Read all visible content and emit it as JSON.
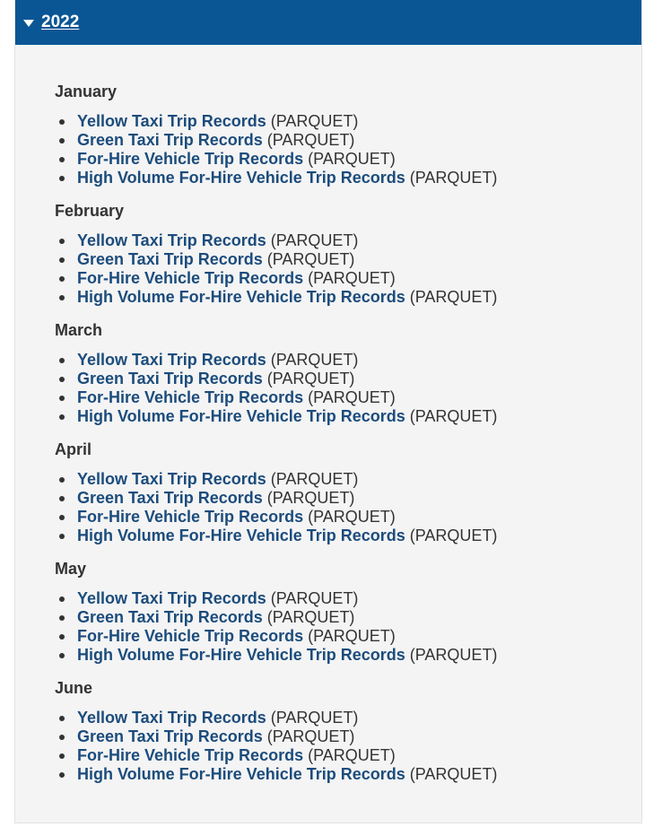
{
  "section": {
    "year": "2022"
  },
  "months": [
    {
      "name": "January",
      "records": [
        {
          "label": "Yellow Taxi Trip Records",
          "format": "(PARQUET)"
        },
        {
          "label": "Green Taxi Trip Records",
          "format": "(PARQUET)"
        },
        {
          "label": "For-Hire Vehicle Trip Records",
          "format": "(PARQUET)"
        },
        {
          "label": "High Volume For-Hire Vehicle Trip Records",
          "format": "(PARQUET)"
        }
      ]
    },
    {
      "name": "February",
      "records": [
        {
          "label": "Yellow Taxi Trip Records",
          "format": "(PARQUET)"
        },
        {
          "label": "Green Taxi Trip Records",
          "format": "(PARQUET)"
        },
        {
          "label": "For-Hire Vehicle Trip Records",
          "format": "(PARQUET)"
        },
        {
          "label": "High Volume For-Hire Vehicle Trip Records",
          "format": "(PARQUET)"
        }
      ]
    },
    {
      "name": "March",
      "records": [
        {
          "label": "Yellow Taxi Trip Records",
          "format": "(PARQUET)"
        },
        {
          "label": "Green Taxi Trip Records",
          "format": "(PARQUET)"
        },
        {
          "label": "For-Hire Vehicle Trip Records",
          "format": "(PARQUET)"
        },
        {
          "label": "High Volume For-Hire Vehicle Trip Records",
          "format": "(PARQUET)"
        }
      ]
    },
    {
      "name": "April",
      "records": [
        {
          "label": "Yellow Taxi Trip Records",
          "format": "(PARQUET)"
        },
        {
          "label": "Green Taxi Trip Records",
          "format": "(PARQUET)"
        },
        {
          "label": "For-Hire Vehicle Trip Records",
          "format": "(PARQUET)"
        },
        {
          "label": "High Volume For-Hire Vehicle Trip Records",
          "format": "(PARQUET)"
        }
      ]
    },
    {
      "name": "May",
      "records": [
        {
          "label": "Yellow Taxi Trip Records",
          "format": "(PARQUET)"
        },
        {
          "label": "Green Taxi Trip Records",
          "format": "(PARQUET)"
        },
        {
          "label": "For-Hire Vehicle Trip Records",
          "format": "(PARQUET)"
        },
        {
          "label": "High Volume For-Hire Vehicle Trip Records",
          "format": "(PARQUET)"
        }
      ]
    },
    {
      "name": "June",
      "records": [
        {
          "label": "Yellow Taxi Trip Records",
          "format": "(PARQUET)"
        },
        {
          "label": "Green Taxi Trip Records",
          "format": "(PARQUET)"
        },
        {
          "label": "For-Hire Vehicle Trip Records",
          "format": "(PARQUET)"
        },
        {
          "label": "High Volume For-Hire Vehicle Trip Records",
          "format": "(PARQUET)"
        }
      ]
    }
  ],
  "icons": {
    "toggle": "caret-down-icon"
  },
  "colors": {
    "header_bg": "#0a5695",
    "link": "#1c4c7c",
    "text": "#333333",
    "panel_bg": "#f4f4f4"
  }
}
